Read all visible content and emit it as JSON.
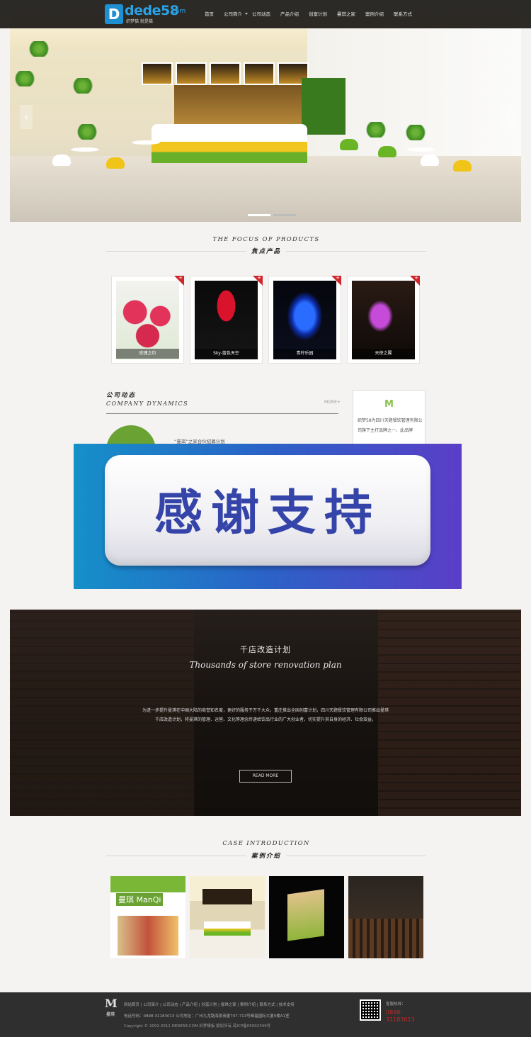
{
  "header": {
    "logo_main": "dede58",
    "logo_com": ".com",
    "logo_slogan": "织梦猫 就是猫",
    "nav": [
      {
        "label": "首页",
        "has_sub": false
      },
      {
        "label": "公司简介",
        "has_sub": true
      },
      {
        "label": "公司动态",
        "has_sub": false
      },
      {
        "label": "产品介绍",
        "has_sub": false
      },
      {
        "label": "创富计划",
        "has_sub": false
      },
      {
        "label": "曼琪之家",
        "has_sub": false
      },
      {
        "label": "案例介绍",
        "has_sub": false
      },
      {
        "label": "联系方式",
        "has_sub": false
      }
    ]
  },
  "hero": {
    "slides": 2,
    "active_slide": 1,
    "arrow_left": "‹",
    "arrow_right": "›"
  },
  "products": {
    "title_en": "THE FOCUS OF PRODUCTS",
    "title_cn": "焦点产品",
    "items": [
      {
        "name": "玫瑰之约"
      },
      {
        "name": "Sky-蓝色天空"
      },
      {
        "name": "青柠乐园"
      },
      {
        "name": "天使之翼"
      }
    ]
  },
  "news": {
    "title_cn": "公司动态",
    "title_en": "COMPANY DYNAMICS",
    "more": "MORE+",
    "item_title": "“曼琪”之家合伙招募计划"
  },
  "about": {
    "mark": "M",
    "text": "织梦58为四川天题餐饮管理有限公司旗下主打品牌之一，此品牌"
  },
  "overlay": {
    "text": "感谢支持"
  },
  "plan": {
    "title_cn": "千店改造计划",
    "title_en": "Thousands of store renovation plan",
    "desc": "为进一步提升曼琪在中国大陆的商誉知名度，更好的服务于万千大众，重庄推出全国创富计划，四川天题餐饮管理有限公司推出曼琪千店改造计划，将曼琪的管理、运营、文化等理念传递给饮品行业的广大创业者，切实提升其自身的经济、社会效益。",
    "button": "READ MORE"
  },
  "cases": {
    "title_en": "CASE INTRODUCTION",
    "title_cn": "案例介绍",
    "sign_text": "曼琪 ManQi"
  },
  "footer": {
    "logo": "M",
    "logo_sub": "曼琪",
    "links": "网站首页 | 公司简介 | 公司动态 | 产品介绍 | 创富计划 | 曼琪之家 | 案例介绍 | 联系方式 | 技术支持",
    "contact": "电话号码：0898-31183013 公司地址：广州九龙路海景商厦707-713号都福国际大厦9楼A1室",
    "copyright": "Copyright © 2002-2011 DEDE58.COM 织梦模板 版权所有 琼ICP备05002349号",
    "hotline_label": "客服热线：",
    "hotline": "0898-31183013"
  }
}
